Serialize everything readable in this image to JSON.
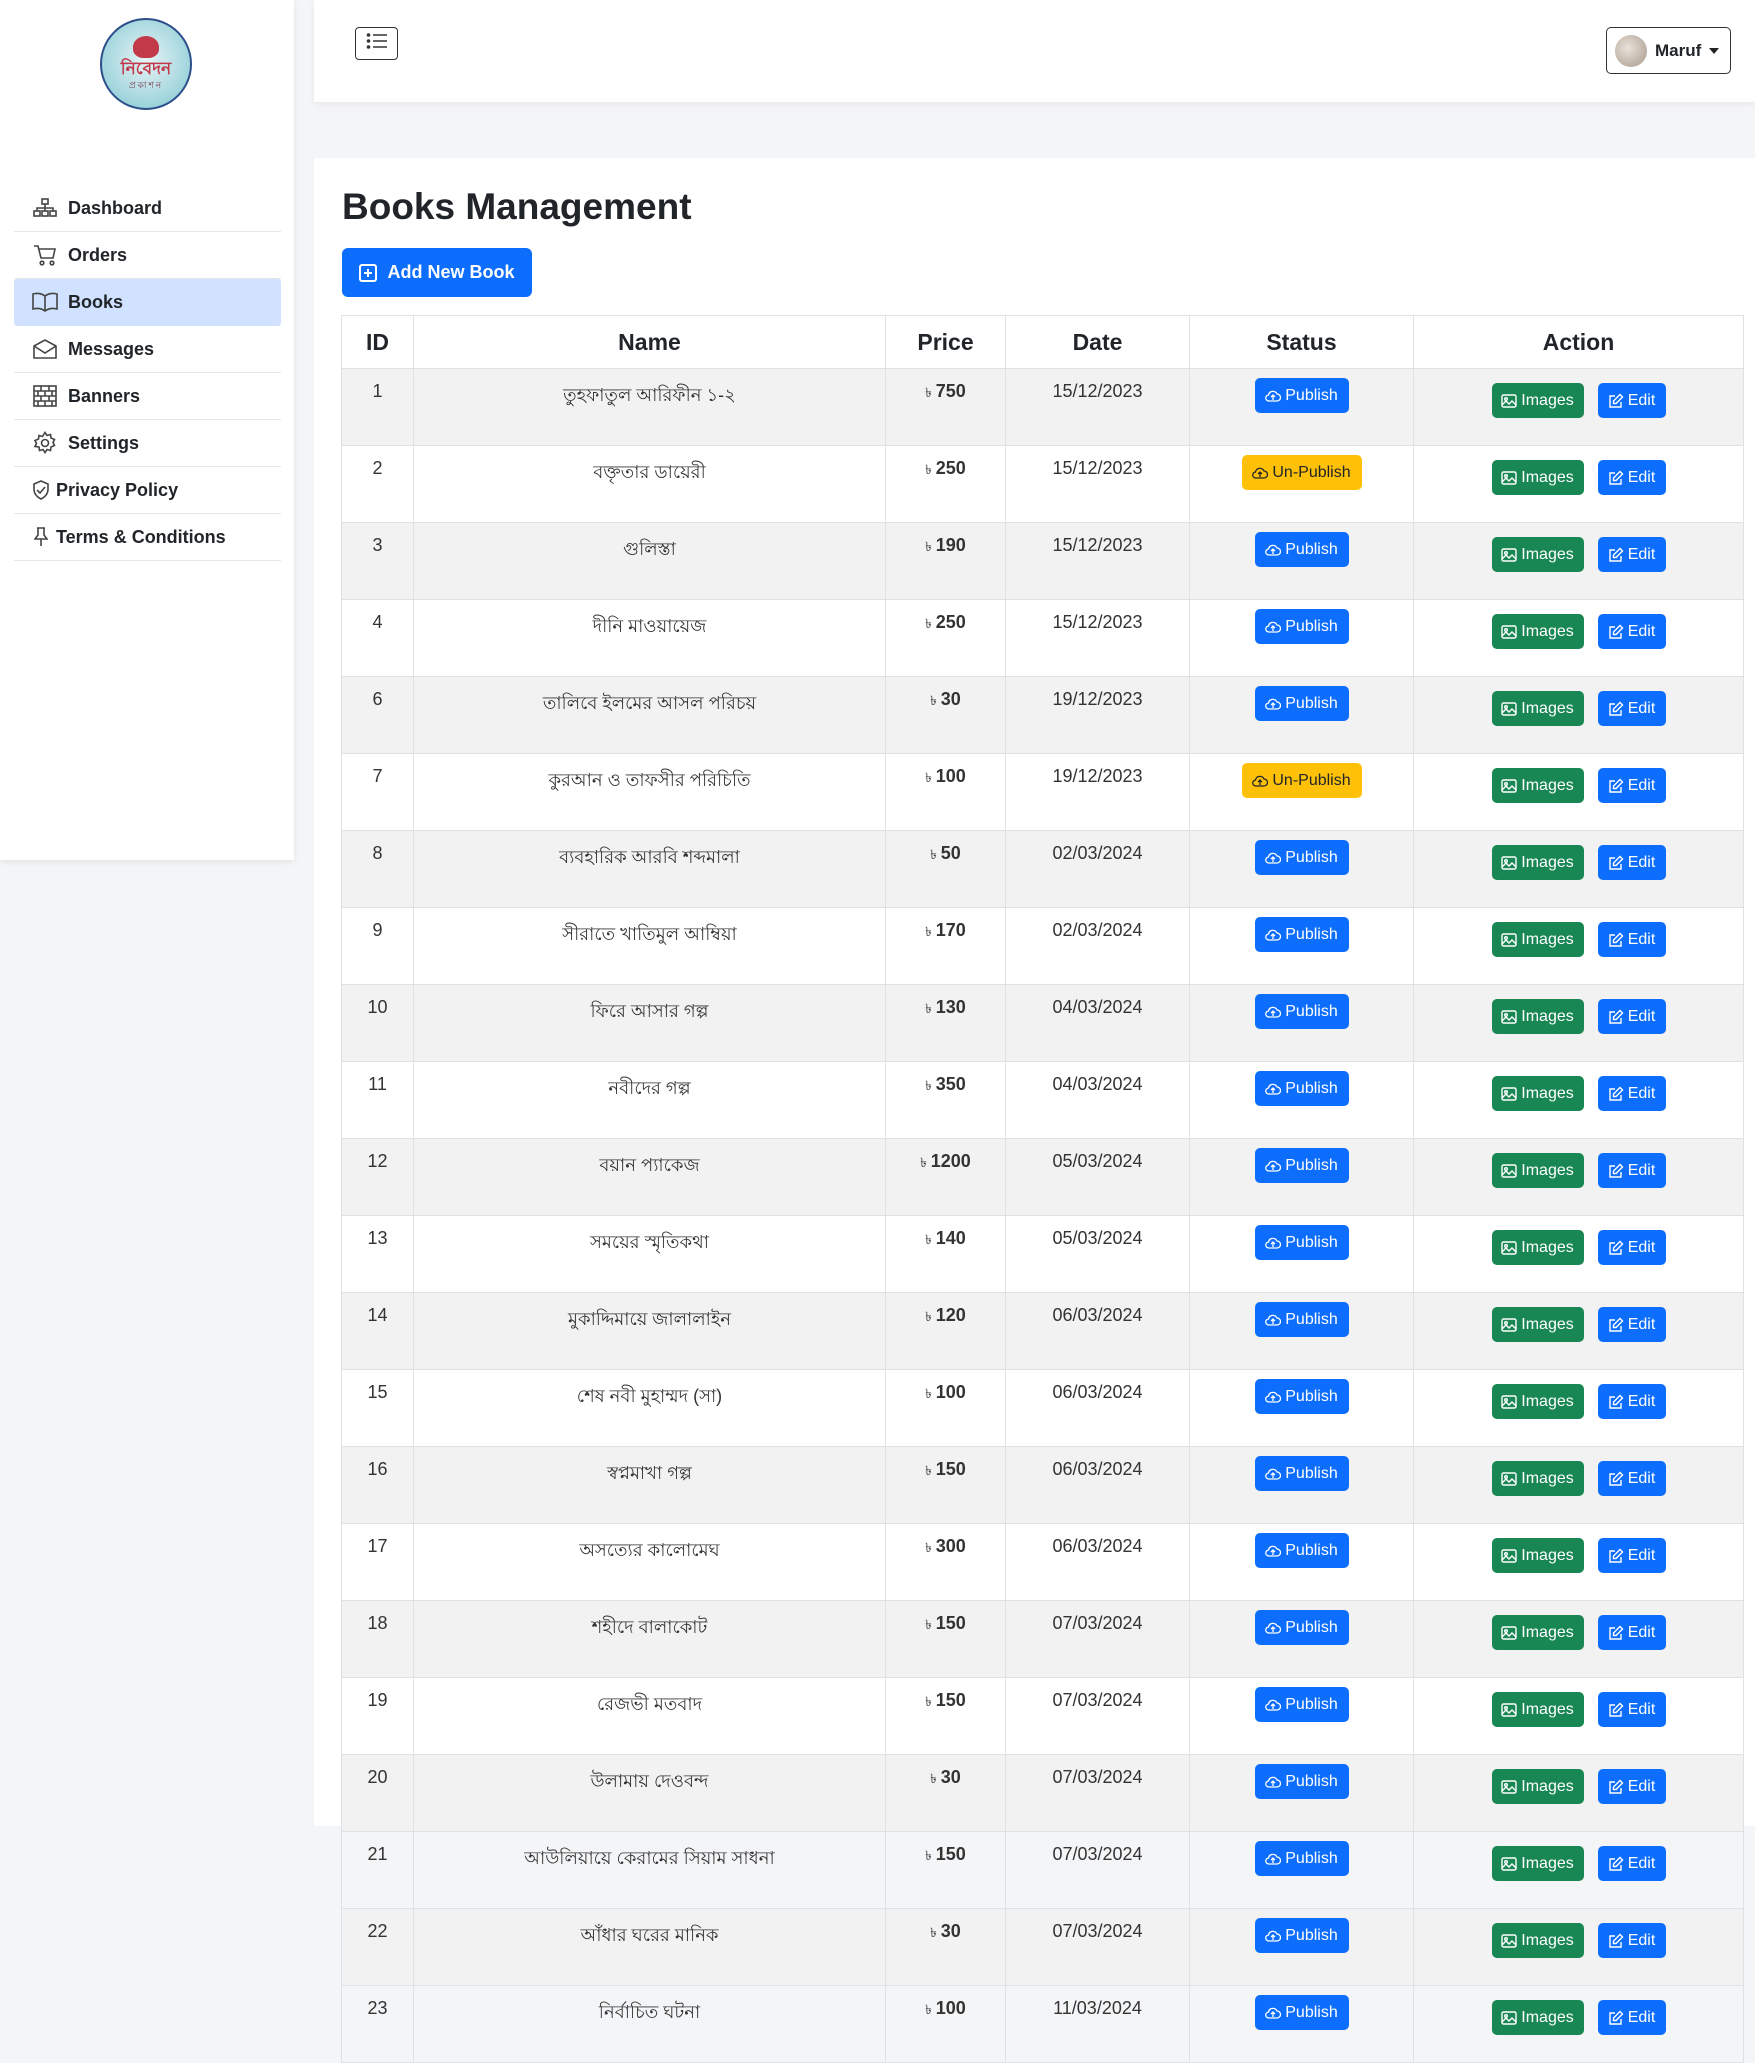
{
  "brand": {
    "logo_text": "নিবেদন",
    "logo_sub": "প্রকাশন"
  },
  "sidebar": {
    "items": [
      {
        "label": "Dashboard",
        "icon": "sitemap-icon"
      },
      {
        "label": "Orders",
        "icon": "cart-icon"
      },
      {
        "label": "Books",
        "icon": "book-icon",
        "active": true
      },
      {
        "label": "Messages",
        "icon": "envelope-icon"
      },
      {
        "label": "Banners",
        "icon": "bricks-icon"
      },
      {
        "label": "Settings",
        "icon": "gear-icon"
      },
      {
        "label": "Privacy Policy",
        "icon": "shield-icon"
      },
      {
        "label": "Terms & Conditions",
        "icon": "pin-icon"
      }
    ]
  },
  "header": {
    "user_name": "Maruf"
  },
  "main": {
    "title": "Books Management",
    "add_button": "Add New Book",
    "columns": [
      "ID",
      "Name",
      "Price",
      "Date",
      "Status",
      "Action"
    ],
    "currency_symbol": "৳",
    "publish_label": "Publish",
    "unpublish_label": "Un-Publish",
    "images_label": "Images",
    "edit_label": "Edit",
    "rows": [
      {
        "id": "1",
        "name": "তুহফাতুল আরিফীন ১-২",
        "price": "750",
        "date": "15/12/2023",
        "status": "Publish"
      },
      {
        "id": "2",
        "name": "বক্তৃতার ডায়েরী",
        "price": "250",
        "date": "15/12/2023",
        "status": "Un-Publish"
      },
      {
        "id": "3",
        "name": "গুলিস্তা",
        "price": "190",
        "date": "15/12/2023",
        "status": "Publish"
      },
      {
        "id": "4",
        "name": "দীনি মাওয়ায়েজ",
        "price": "250",
        "date": "15/12/2023",
        "status": "Publish"
      },
      {
        "id": "6",
        "name": "তালিবে ইলমের আসল পরিচয়",
        "price": "30",
        "date": "19/12/2023",
        "status": "Publish"
      },
      {
        "id": "7",
        "name": "কুরআন ও তাফসীর পরিচিতি",
        "price": "100",
        "date": "19/12/2023",
        "status": "Un-Publish"
      },
      {
        "id": "8",
        "name": "ব্যবহারিক আরবি শব্দমালা",
        "price": "50",
        "date": "02/03/2024",
        "status": "Publish"
      },
      {
        "id": "9",
        "name": "সীরাতে খাতিমুল আম্বিয়া",
        "price": "170",
        "date": "02/03/2024",
        "status": "Publish"
      },
      {
        "id": "10",
        "name": "ফিরে আসার গল্প",
        "price": "130",
        "date": "04/03/2024",
        "status": "Publish"
      },
      {
        "id": "11",
        "name": "নবীদের গল্প",
        "price": "350",
        "date": "04/03/2024",
        "status": "Publish"
      },
      {
        "id": "12",
        "name": "বয়ান প্যাকেজ",
        "price": "1200",
        "date": "05/03/2024",
        "status": "Publish"
      },
      {
        "id": "13",
        "name": "সময়ের স্মৃতিকথা",
        "price": "140",
        "date": "05/03/2024",
        "status": "Publish"
      },
      {
        "id": "14",
        "name": "মুকাদ্দিমায়ে জালালাইন",
        "price": "120",
        "date": "06/03/2024",
        "status": "Publish"
      },
      {
        "id": "15",
        "name": "শেষ নবী মুহাম্মদ (সা)",
        "price": "100",
        "date": "06/03/2024",
        "status": "Publish"
      },
      {
        "id": "16",
        "name": "স্বপ্নমাখা গল্প",
        "price": "150",
        "date": "06/03/2024",
        "status": "Publish"
      },
      {
        "id": "17",
        "name": "অসত্যের কালোমেঘ",
        "price": "300",
        "date": "06/03/2024",
        "status": "Publish"
      },
      {
        "id": "18",
        "name": "শহীদে বালাকোট",
        "price": "150",
        "date": "07/03/2024",
        "status": "Publish"
      },
      {
        "id": "19",
        "name": "রেজভী মতবাদ",
        "price": "150",
        "date": "07/03/2024",
        "status": "Publish"
      },
      {
        "id": "20",
        "name": "উলামায় দেওবন্দ",
        "price": "30",
        "date": "07/03/2024",
        "status": "Publish"
      },
      {
        "id": "21",
        "name": "আউলিয়ায়ে কেরামের সিয়াম সাধনা",
        "price": "150",
        "date": "07/03/2024",
        "status": "Publish"
      },
      {
        "id": "22",
        "name": "আঁধার ঘরের মানিক",
        "price": "30",
        "date": "07/03/2024",
        "status": "Publish"
      },
      {
        "id": "23",
        "name": "নির্বাচিত ঘটনা",
        "price": "100",
        "date": "11/03/2024",
        "status": "Publish"
      }
    ]
  },
  "colors": {
    "primary": "#0d6efd",
    "success": "#198754",
    "warning": "#ffc107",
    "active_nav": "#d0e2ff"
  }
}
